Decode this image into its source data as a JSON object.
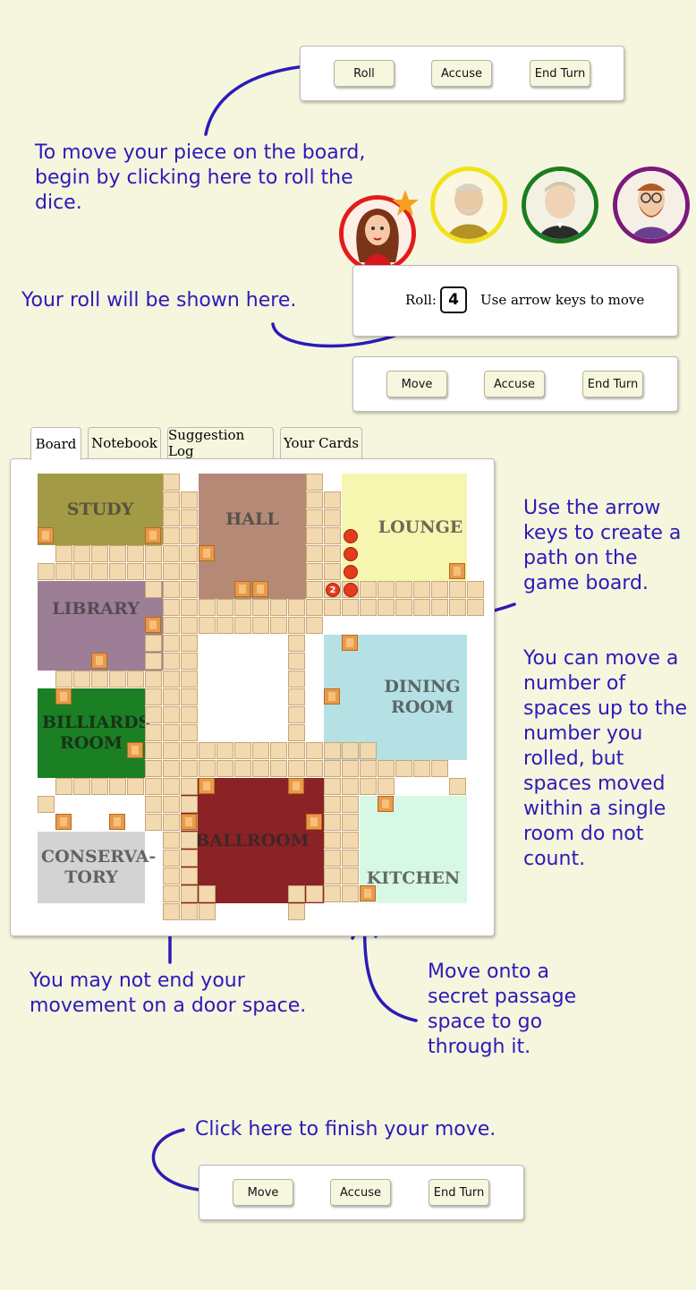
{
  "top_controls": {
    "roll": "Roll",
    "accuse": "Accuse",
    "end_turn": "End Turn"
  },
  "notes": {
    "roll_dice": "To move your piece on the board, begin by clicking here to roll the dice.",
    "roll_shown": "Your roll will be shown here.",
    "arrow_keys": "Use the arrow keys to create a path on the game board.",
    "move_count": "You can move a number of spaces up to the number you rolled, but spaces moved within a single room do not count.",
    "door_space": "You may not end your movement on a door space.",
    "secret_passage": "Move onto a secret passage space to go through it.",
    "finish_move": "Click here to finish your move."
  },
  "roll_panel": {
    "label": "Roll:",
    "value": "4",
    "instruction": "Use arrow keys to move"
  },
  "mid_controls": {
    "move": "Move",
    "accuse": "Accuse",
    "end_turn": "End Turn"
  },
  "bottom_controls": {
    "move": "Move",
    "accuse": "Accuse",
    "end_turn": "End Turn"
  },
  "tabs": [
    "Board",
    "Notebook",
    "Suggestion Log",
    "Your Cards"
  ],
  "rooms": {
    "study": "STUDY",
    "hall": "HALL",
    "lounge": "LOUNGE",
    "library": "LIBRARY",
    "billiards": "BILLIARDS ROOM",
    "dining": "DINING ROOM",
    "conservatory": "CONSERVA- TORY",
    "ballroom": "BALLROOM",
    "kitchen": "KITCHEN"
  },
  "path_marker": "2",
  "players": [
    {
      "icon": "miss-scarlet-avatar",
      "ring": "#e31b1b"
    },
    {
      "icon": "colonel-mustard-avatar",
      "ring": "#f2e21a"
    },
    {
      "icon": "mr-green-avatar",
      "ring": "#1a7d1f"
    },
    {
      "icon": "professor-plum-avatar",
      "ring": "#7a1a7a"
    }
  ],
  "colors": {
    "annotation": "#2b1bb8",
    "background": "#f6f5de",
    "path": "#e43b1c"
  }
}
